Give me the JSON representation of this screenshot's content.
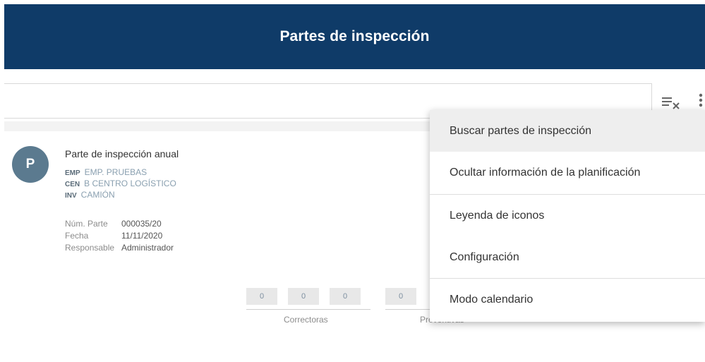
{
  "header": {
    "title": "Partes de inspección"
  },
  "toolbar": {
    "clear_filter_icon": "filter-clear-icon",
    "more_icon": "more-vert-icon"
  },
  "card": {
    "avatar_letter": "P",
    "title": "Parte de inspección anual",
    "tags": [
      {
        "code": "EMP",
        "value": "EMP. PRUEBAS"
      },
      {
        "code": "CEN",
        "value": "B CENTRO LOGÍSTICO"
      },
      {
        "code": "INV",
        "value": "CAMIÓN"
      }
    ],
    "details": [
      {
        "label": "Núm. Parte",
        "value": "000035/20"
      },
      {
        "label": "Fecha",
        "value": "11/11/2020"
      },
      {
        "label": "Responsable",
        "value": "Administrador"
      }
    ],
    "counters": {
      "correctoras": {
        "label": "Correctoras",
        "values": [
          "0",
          "0",
          "0"
        ]
      },
      "preventivas": {
        "label": "Preventivas",
        "values": [
          "0"
        ]
      }
    }
  },
  "menu": {
    "items": [
      {
        "label": "Buscar partes de inspección"
      },
      {
        "label": "Ocultar información de la planificación"
      },
      {
        "label": "Leyenda de iconos"
      },
      {
        "label": "Configuración"
      },
      {
        "label": "Modo calendario"
      }
    ]
  },
  "colors": {
    "header": "#0f3b68",
    "avatar": "#5b7a8f"
  }
}
